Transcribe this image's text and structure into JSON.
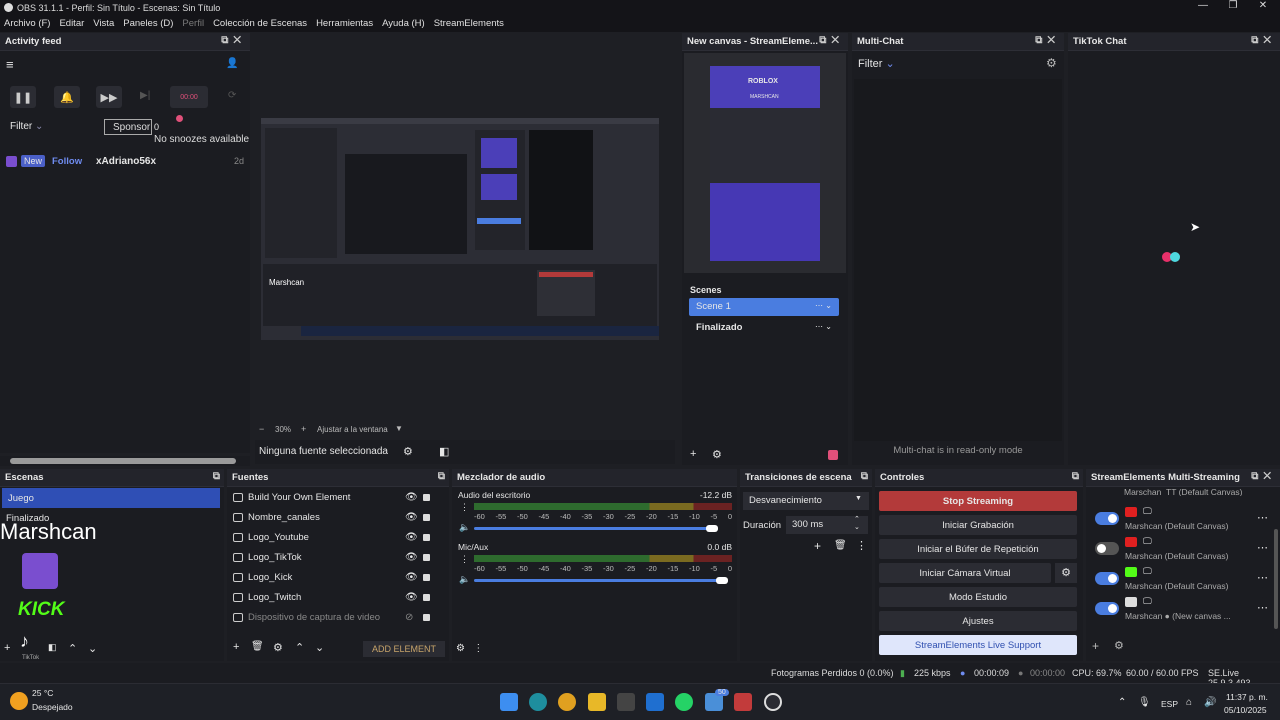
{
  "app": {
    "title": "OBS 31.1.1 - Perfil: Sin Título - Escenas: Sin Título"
  },
  "menu": [
    {
      "label": "Archivo (F)"
    },
    {
      "label": "Editar"
    },
    {
      "label": "Vista"
    },
    {
      "label": "Paneles (D)"
    },
    {
      "label": "Perfil",
      "dim": true
    },
    {
      "label": "Colección de Escenas"
    },
    {
      "label": "Herramientas"
    },
    {
      "label": "Ayuda (H)"
    },
    {
      "label": "StreamElements"
    }
  ],
  "activity": {
    "title": "Activity feed",
    "filter": "Filter",
    "sponsor": "Sponsor",
    "sponsor_count": "0",
    "tooltip": "No snoozes available",
    "feed": [
      {
        "badge": "New",
        "type": "Follow",
        "user": "xAdriano56x",
        "time": "2d"
      }
    ]
  },
  "preview": {
    "zoom": "30%",
    "fit": "Ajustar a la ventana"
  },
  "canvas": {
    "title": "New canvas - StreamEleme...",
    "thumb_text_1": "ROBLOX",
    "thumb_text_2": "MARSHCAN"
  },
  "canvas_scenes": {
    "title": "Scenes",
    "items": [
      "Scene 1",
      "Finalizado"
    ]
  },
  "multichat": {
    "title": "Multi-Chat",
    "filter": "Filter",
    "footer": "Multi-chat is in read-only mode"
  },
  "tiktok": {
    "title": "TikTok Chat"
  },
  "no_source": "Ninguna fuente seleccionada",
  "scenes": {
    "title": "Escenas",
    "items": [
      "Juego",
      "Finalizado"
    ]
  },
  "overlay": {
    "channel": "Marshcan",
    "kick": "KICK",
    "tiktok": "TikTok"
  },
  "sources": {
    "title": "Fuentes",
    "items": [
      {
        "name": "Build Your Own Element"
      },
      {
        "name": "Nombre_canales"
      },
      {
        "name": "Logo_Youtube"
      },
      {
        "name": "Logo_TikTok"
      },
      {
        "name": "Logo_Kick"
      },
      {
        "name": "Logo_Twitch"
      },
      {
        "name": "Dispositivo de captura de video",
        "dim": true
      }
    ],
    "add": "ADD ELEMENT"
  },
  "mixer": {
    "title": "Mezclador de audio",
    "tracks": [
      {
        "name": "Audio del escritorio",
        "db": "-12.2 dB",
        "level": 0.96
      },
      {
        "name": "Mic/Aux",
        "db": "0.0 dB",
        "level": 1.0
      }
    ],
    "ticks": [
      "-60",
      "-55",
      "-50",
      "-45",
      "-40",
      "-35",
      "-30",
      "-25",
      "-20",
      "-15",
      "-10",
      "-5",
      "0"
    ]
  },
  "transitions": {
    "title": "Transiciones de escena",
    "selected": "Desvanecimiento",
    "duration_label": "Duración",
    "duration": "300 ms"
  },
  "controls": {
    "title": "Controles",
    "buttons": [
      "Stop Streaming",
      "Iniciar Grabación",
      "Iniciar el Búfer de Repetición",
      "Iniciar Cámara Virtual",
      "Modo Estudio",
      "Ajustes",
      "StreamElements Live Support"
    ]
  },
  "multistream": {
    "title": "StreamElements Multi-Streaming",
    "top_partial": "Marschan_TT (Default Canvas)",
    "rows": [
      {
        "name": "Marshcan (Default Canvas)",
        "enabled": true,
        "platform": "YouTube"
      },
      {
        "name": "Marshcan (Default Canvas)",
        "enabled": false,
        "platform": "YouTube"
      },
      {
        "name": "Marshcan (Default Canvas)",
        "enabled": true,
        "platform": "Kick"
      },
      {
        "name": "Marshcan ● (New canvas ...",
        "enabled": true,
        "platform": "TikTok"
      }
    ]
  },
  "status": {
    "dropped": "Fotogramas Perdidos 0 (0.0%)",
    "kbps": "225 kbps",
    "stream_time": "00:00:09",
    "rec_time": "00:00:00",
    "cpu": "CPU: 69.7%",
    "fps": "60.00 / 60.00 FPS",
    "se": "SE.Live 25.9.3.493"
  },
  "taskbar": {
    "weather_temp": "25 °C",
    "weather": "Despejado",
    "lang": "ESP",
    "time": "11:37 p. m.",
    "date": "05/10/2025",
    "badge": "50"
  },
  "colors": {
    "accent": "#4a7de0",
    "stop": "#b33a3a",
    "support": "#dfe6fb"
  }
}
